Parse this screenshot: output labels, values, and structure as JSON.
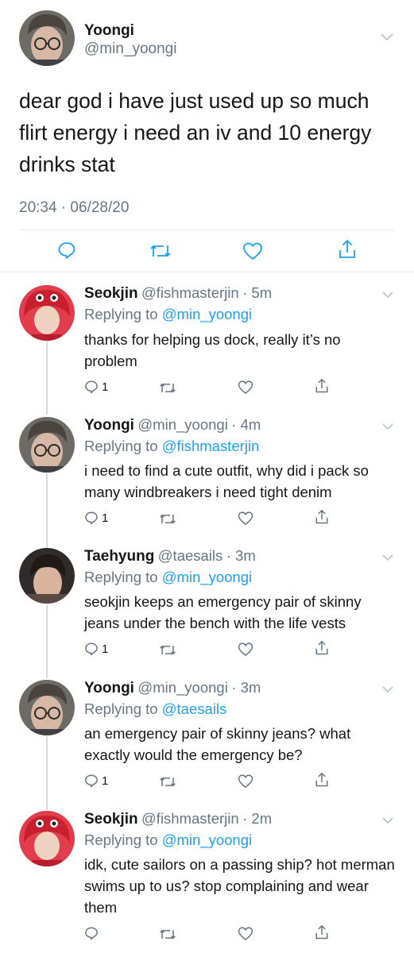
{
  "main_tweet": {
    "name": "Yoongi",
    "handle": "@min_yoongi",
    "text": "dear god i have just used up so much flirt energy i need an iv and 10 energy drinks stat",
    "timestamp": "20:34 · 06/28/20"
  },
  "replies": [
    {
      "name": "Seokjin",
      "handle": "@fishmasterjin",
      "time": "· 5m",
      "replying_prefix": "Replying to",
      "replying_to": "@min_yoongi",
      "text": "thanks for helping us dock, really it’s no problem",
      "reply_count": "1"
    },
    {
      "name": "Yoongi",
      "handle": "@min_yoongi",
      "time": "· 4m",
      "replying_prefix": "Replying to",
      "replying_to": "@fishmasterjin",
      "text": "i need to find a cute outfit, why did i pack so many windbreakers i need tight denim",
      "reply_count": "1"
    },
    {
      "name": "Taehyung",
      "handle": "@taesails",
      "time": "· 3m",
      "replying_prefix": "Replying to",
      "replying_to": "@min_yoongi",
      "text": "seokjin keeps an emergency pair of skinny jeans under the bench with the life vests",
      "reply_count": "1"
    },
    {
      "name": "Yoongi",
      "handle": "@min_yoongi",
      "time": "· 3m",
      "replying_prefix": "Replying to",
      "replying_to": "@taesails",
      "text": "an emergency pair of skinny jeans? what exactly would the emergency be?",
      "reply_count": "1"
    },
    {
      "name": "Seokjin",
      "handle": "@fishmasterjin",
      "time": "· 2m",
      "replying_prefix": "Replying to",
      "replying_to": "@min_yoongi",
      "text": "idk, cute sailors on a passing ship? hot merman swims up to us? stop complaining and wear them",
      "reply_count": ""
    }
  ],
  "colors": {
    "link": "#1da1f2",
    "muted": "#657786",
    "text": "#14171a",
    "divider": "#e1e8ed"
  },
  "icons": [
    "chevron-down-icon",
    "reply-icon",
    "retweet-icon",
    "like-icon",
    "share-icon"
  ]
}
